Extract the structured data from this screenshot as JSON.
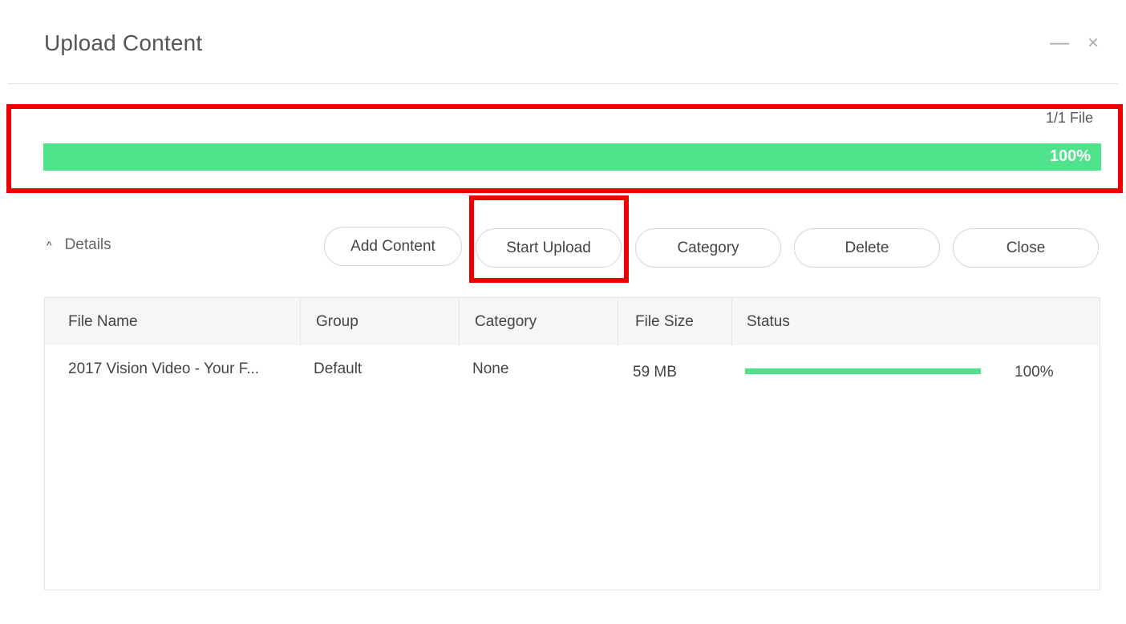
{
  "window": {
    "title": "Upload Content",
    "minimize_glyph": "—",
    "close_glyph": "×"
  },
  "overall": {
    "file_count": "1/1 File",
    "progress_label": "100%",
    "progress": 1.0,
    "bar_color": "#4ee38b"
  },
  "details": {
    "caret_glyph": "^",
    "label": "Details"
  },
  "toolbar": {
    "add_content": "Add Content",
    "start_upload": "Start Upload",
    "category": "Category",
    "delete": "Delete",
    "close": "Close"
  },
  "table": {
    "columns": [
      "File Name",
      "Group",
      "Category",
      "File Size",
      "Status"
    ],
    "rows": [
      {
        "file_name": "2017 Vision Video - Your F...",
        "group": "Default",
        "category": "None",
        "file_size": "59 MB",
        "status_progress": 1.0,
        "status_label": "100%"
      }
    ]
  },
  "highlight_color": "#ee0000"
}
